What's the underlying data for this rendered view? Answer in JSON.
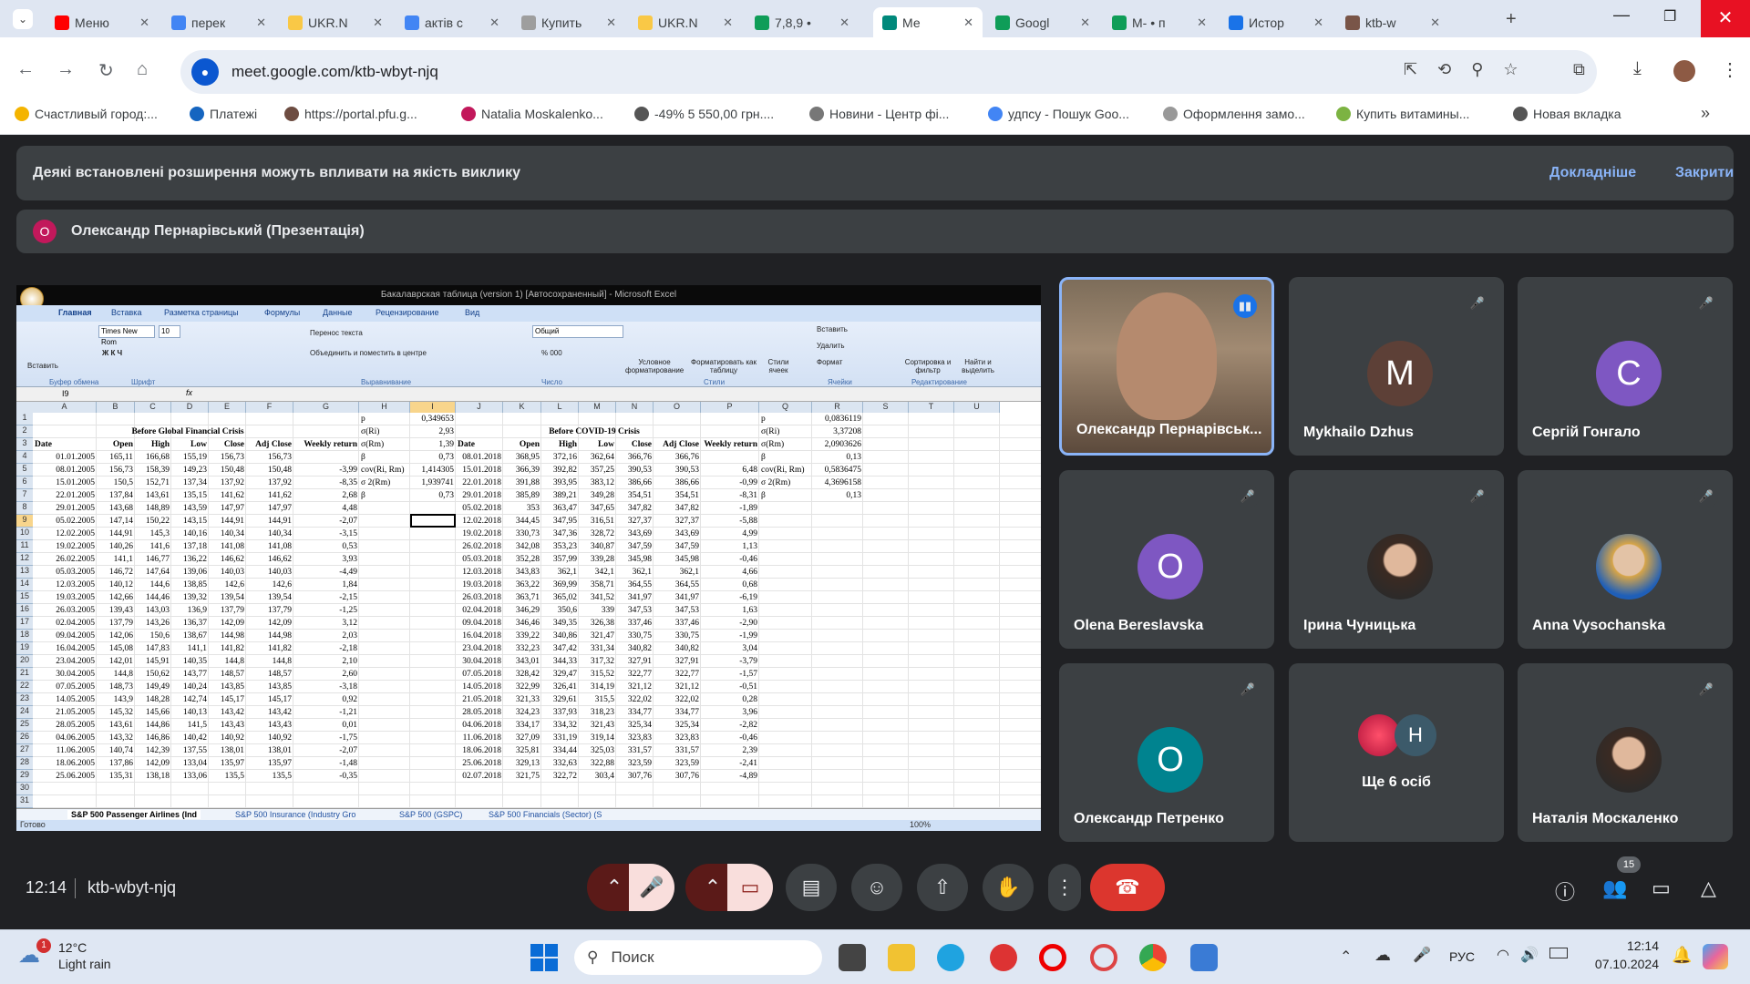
{
  "browser": {
    "tabs": [
      {
        "label": "Меню",
        "color": "#ff0000"
      },
      {
        "label": "перек",
        "color": "#4285f4"
      },
      {
        "label": "UKR.N",
        "color": "#f9c846"
      },
      {
        "label": "актів с",
        "color": "#4285f4"
      },
      {
        "label": "Купить",
        "color": "#9e9e9e"
      },
      {
        "label": "UKR.N",
        "color": "#f9c846"
      },
      {
        "label": "7,8,9 •",
        "color": "#0f9d58"
      },
      {
        "label": "Ме",
        "color": "#00897b"
      },
      {
        "label": "Googl",
        "color": "#0f9d58"
      },
      {
        "label": "М- • п",
        "color": "#0f9d58"
      },
      {
        "label": "Истор",
        "color": "#1a73e8"
      },
      {
        "label": "ktb-w",
        "color": "#795548"
      }
    ],
    "url": "meet.google.com/ktb-wbyt-njq",
    "bookmarks": [
      "Счастливый город:...",
      "Платежі",
      "https://portal.pfu.g...",
      "Natalia Moskalenko...",
      "-49% 5 550,00 грн....",
      "Новини - Центр фі...",
      "удпсу - Пошук Goo...",
      "Оформлення замо...",
      "Купить витамины...",
      "Новая вкладка"
    ]
  },
  "meet": {
    "banner_text": "Деякі встановлені розширення можуть впливати на якість виклику",
    "banner_more": "Докладніше",
    "banner_close": "Закрити",
    "presenter_initial": "О",
    "presenter_label": "Олександр Пернарівський (Презентація)",
    "time": "12:14",
    "meeting_code": "ktb-wbyt-njq",
    "participants_count": "15",
    "tiles": [
      {
        "name": "Олександр Пернарівськ...",
        "type": "video"
      },
      {
        "name": "Mykhailo Dzhus",
        "initial": "M",
        "color": "#5d4037"
      },
      {
        "name": "Сергій Гонгало",
        "initial": "C",
        "color": "#7e57c2"
      },
      {
        "name": "Olena Bereslavska",
        "initial": "O",
        "color": "#7e57c2"
      },
      {
        "name": "Ірина Чуницька",
        "type": "photo"
      },
      {
        "name": "Anna Vysochanska",
        "type": "photo"
      },
      {
        "name": "Олександр Петренко",
        "initial": "O",
        "color": "#00838f"
      },
      {
        "name": "Ще 6 осіб",
        "initial": "Н",
        "type": "group"
      },
      {
        "name": "Наталія Москаленко",
        "type": "photo"
      }
    ]
  },
  "excel": {
    "title": "Бакалаврская таблица (version 1) [Автосохраненный] - Microsoft Excel",
    "ribbon_tabs": [
      "Главная",
      "Вставка",
      "Разметка страницы",
      "Формулы",
      "Данные",
      "Рецензирование",
      "Вид"
    ],
    "font_name": "Times New Rom",
    "font_size": "10",
    "number_format": "Общий",
    "wrap_text": "Перенос текста",
    "merge_center": "Объединить и поместить в центре",
    "paste": "Вставить",
    "cond_format": "Условное форматирование",
    "format_table": "Форматировать как таблицу",
    "cell_styles": "Стили ячеек",
    "insert": "Вставить",
    "delete": "Удалить",
    "format": "Формат",
    "sort_filter": "Сортировка и фильтр",
    "find_select": "Найти и выделить",
    "groups": [
      "Буфер обмена",
      "Шрифт",
      "Выравнивание",
      "Число",
      "Стили",
      "Ячейки",
      "Редактирование"
    ],
    "name_box": "I9",
    "columns": [
      "A",
      "B",
      "C",
      "D",
      "E",
      "F",
      "G",
      "H",
      "I",
      "J",
      "K",
      "L",
      "M",
      "N",
      "O",
      "P",
      "Q",
      "R",
      "S",
      "T",
      "U"
    ],
    "header1": "Before Global Financial Crisis",
    "header2": "Before COVID-19 Crisis",
    "col_headers_left": [
      "Date",
      "Open",
      "High",
      "Low",
      "Close",
      "Adj Close",
      "Weekly return"
    ],
    "col_headers_right": [
      "Date",
      "Open",
      "High",
      "Low",
      "Close",
      "Adj Close",
      "Weekly return"
    ],
    "rows_left": [
      [
        "01.01.2005",
        "165,11",
        "166,68",
        "155,19",
        "156,73",
        "156,73",
        ""
      ],
      [
        "08.01.2005",
        "156,73",
        "158,39",
        "149,23",
        "150,48",
        "150,48",
        "-3,99"
      ],
      [
        "15.01.2005",
        "150,5",
        "152,71",
        "137,34",
        "137,92",
        "137,92",
        "-8,35"
      ],
      [
        "22.01.2005",
        "137,84",
        "143,61",
        "135,15",
        "141,62",
        "141,62",
        "2,68"
      ],
      [
        "29.01.2005",
        "143,68",
        "148,89",
        "143,59",
        "147,97",
        "147,97",
        "4,48"
      ],
      [
        "05.02.2005",
        "147,14",
        "150,22",
        "143,15",
        "144,91",
        "144,91",
        "-2,07"
      ],
      [
        "12.02.2005",
        "144,91",
        "145,3",
        "140,16",
        "140,34",
        "140,34",
        "-3,15"
      ],
      [
        "19.02.2005",
        "140,26",
        "141,6",
        "137,18",
        "141,08",
        "141,08",
        "0,53"
      ],
      [
        "26.02.2005",
        "141,1",
        "146,77",
        "136,22",
        "146,62",
        "146,62",
        "3,93"
      ],
      [
        "05.03.2005",
        "146,72",
        "147,64",
        "139,06",
        "140,03",
        "140,03",
        "-4,49"
      ],
      [
        "12.03.2005",
        "140,12",
        "144,6",
        "138,85",
        "142,6",
        "142,6",
        "1,84"
      ],
      [
        "19.03.2005",
        "142,66",
        "144,46",
        "139,32",
        "139,54",
        "139,54",
        "-2,15"
      ],
      [
        "26.03.2005",
        "139,43",
        "143,03",
        "136,9",
        "137,79",
        "137,79",
        "-1,25"
      ],
      [
        "02.04.2005",
        "137,79",
        "143,26",
        "136,37",
        "142,09",
        "142,09",
        "3,12"
      ],
      [
        "09.04.2005",
        "142,06",
        "150,6",
        "138,67",
        "144,98",
        "144,98",
        "2,03"
      ],
      [
        "16.04.2005",
        "145,08",
        "147,83",
        "141,1",
        "141,82",
        "141,82",
        "-2,18"
      ],
      [
        "23.04.2005",
        "142,01",
        "145,91",
        "140,35",
        "144,8",
        "144,8",
        "2,10"
      ],
      [
        "30.04.2005",
        "144,8",
        "150,62",
        "143,77",
        "148,57",
        "148,57",
        "2,60"
      ],
      [
        "07.05.2005",
        "148,73",
        "149,49",
        "140,24",
        "143,85",
        "143,85",
        "-3,18"
      ],
      [
        "14.05.2005",
        "143,9",
        "148,28",
        "142,74",
        "145,17",
        "145,17",
        "0,92"
      ],
      [
        "21.05.2005",
        "145,32",
        "145,66",
        "140,13",
        "143,42",
        "143,42",
        "-1,21"
      ],
      [
        "28.05.2005",
        "143,61",
        "144,86",
        "141,5",
        "143,43",
        "143,43",
        "0,01"
      ],
      [
        "04.06.2005",
        "143,32",
        "146,86",
        "140,42",
        "140,92",
        "140,92",
        "-1,75"
      ],
      [
        "11.06.2005",
        "140,74",
        "142,39",
        "137,55",
        "138,01",
        "138,01",
        "-2,07"
      ],
      [
        "18.06.2005",
        "137,86",
        "142,09",
        "133,04",
        "135,97",
        "135,97",
        "-1,48"
      ],
      [
        "25.06.2005",
        "135,31",
        "138,18",
        "133,06",
        "135,5",
        "135,5",
        "-0,35"
      ]
    ],
    "rows_right": [
      [
        "08.01.2018",
        "368,95",
        "372,16",
        "362,64",
        "366,76",
        "366,76",
        ""
      ],
      [
        "15.01.2018",
        "366,39",
        "392,82",
        "357,25",
        "390,53",
        "390,53",
        "6,48"
      ],
      [
        "22.01.2018",
        "391,88",
        "393,95",
        "383,12",
        "386,66",
        "386,66",
        "-0,99"
      ],
      [
        "29.01.2018",
        "385,89",
        "389,21",
        "349,28",
        "354,51",
        "354,51",
        "-8,31"
      ],
      [
        "05.02.2018",
        "353",
        "363,47",
        "347,65",
        "347,82",
        "347,82",
        "-1,89"
      ],
      [
        "12.02.2018",
        "344,45",
        "347,95",
        "316,51",
        "327,37",
        "327,37",
        "-5,88"
      ],
      [
        "19.02.2018",
        "330,73",
        "347,36",
        "328,72",
        "343,69",
        "343,69",
        "4,99"
      ],
      [
        "26.02.2018",
        "342,08",
        "353,23",
        "340,87",
        "347,59",
        "347,59",
        "1,13"
      ],
      [
        "05.03.2018",
        "352,28",
        "357,99",
        "339,28",
        "345,98",
        "345,98",
        "-0,46"
      ],
      [
        "12.03.2018",
        "343,83",
        "362,1",
        "342,1",
        "362,1",
        "362,1",
        "4,66"
      ],
      [
        "19.03.2018",
        "363,22",
        "369,99",
        "358,71",
        "364,55",
        "364,55",
        "0,68"
      ],
      [
        "26.03.2018",
        "363,71",
        "365,02",
        "341,52",
        "341,97",
        "341,97",
        "-6,19"
      ],
      [
        "02.04.2018",
        "346,29",
        "350,6",
        "339",
        "347,53",
        "347,53",
        "1,63"
      ],
      [
        "09.04.2018",
        "346,46",
        "349,35",
        "326,38",
        "337,46",
        "337,46",
        "-2,90"
      ],
      [
        "16.04.2018",
        "339,22",
        "340,86",
        "321,47",
        "330,75",
        "330,75",
        "-1,99"
      ],
      [
        "23.04.2018",
        "332,23",
        "347,42",
        "331,34",
        "340,82",
        "340,82",
        "3,04"
      ],
      [
        "30.04.2018",
        "343,01",
        "344,33",
        "317,32",
        "327,91",
        "327,91",
        "-3,79"
      ],
      [
        "07.05.2018",
        "328,42",
        "329,47",
        "315,52",
        "322,77",
        "322,77",
        "-1,57"
      ],
      [
        "14.05.2018",
        "322,99",
        "326,41",
        "314,19",
        "321,12",
        "321,12",
        "-0,51"
      ],
      [
        "21.05.2018",
        "321,33",
        "329,61",
        "315,5",
        "322,02",
        "322,02",
        "0,28"
      ],
      [
        "28.05.2018",
        "324,23",
        "337,93",
        "318,23",
        "334,77",
        "334,77",
        "3,96"
      ],
      [
        "04.06.2018",
        "334,17",
        "334,32",
        "321,43",
        "325,34",
        "325,34",
        "-2,82"
      ],
      [
        "11.06.2018",
        "327,09",
        "331,19",
        "319,14",
        "323,83",
        "323,83",
        "-0,46"
      ],
      [
        "18.06.2018",
        "325,81",
        "334,44",
        "325,03",
        "331,57",
        "331,57",
        "2,39"
      ],
      [
        "25.06.2018",
        "329,13",
        "332,63",
        "322,88",
        "323,59",
        "323,59",
        "-2,41"
      ],
      [
        "02.07.2018",
        "321,75",
        "322,72",
        "303,4",
        "307,76",
        "307,76",
        "-4,89"
      ]
    ],
    "stats_left": [
      {
        "label": "p",
        "value": "0,349653"
      },
      {
        "label": "σ(Ri)",
        "value": "2,93"
      },
      {
        "label": "σ(Rm)",
        "value": "1,39"
      },
      {
        "label": "β",
        "value": "0,73"
      },
      {
        "label": "cov(Ri, Rm)",
        "value": "1,414305"
      },
      {
        "label": "σ 2(Rm)",
        "value": "1,939741"
      },
      {
        "label": "β",
        "value": "0,73"
      }
    ],
    "stats_right": [
      {
        "label": "p",
        "value": "0,0836119"
      },
      {
        "label": "σ(Ri)",
        "value": "3,37208"
      },
      {
        "label": "σ(Rm)",
        "value": "2,0903626"
      },
      {
        "label": "β",
        "value": "0,13"
      },
      {
        "label": "cov(Ri, Rm)",
        "value": "0,5836475"
      },
      {
        "label": "σ 2(Rm)",
        "value": "4,3696158"
      },
      {
        "label": "β",
        "value": "0,13"
      }
    ],
    "sheet_tabs": [
      "S&P 500 Passenger Airlines (Ind",
      "S&P 500 Insurance (Industry Gro",
      "S&P 500 (GSPC)",
      "S&P 500 Financials (Sector) (S"
    ],
    "status": "Готово",
    "zoom": "100%"
  },
  "taskbar": {
    "temp": "12°C",
    "weather": "Light rain",
    "weather_badge": "1",
    "search": "Поиск",
    "lang": "РУС",
    "time": "12:14",
    "date": "07.10.2024"
  }
}
